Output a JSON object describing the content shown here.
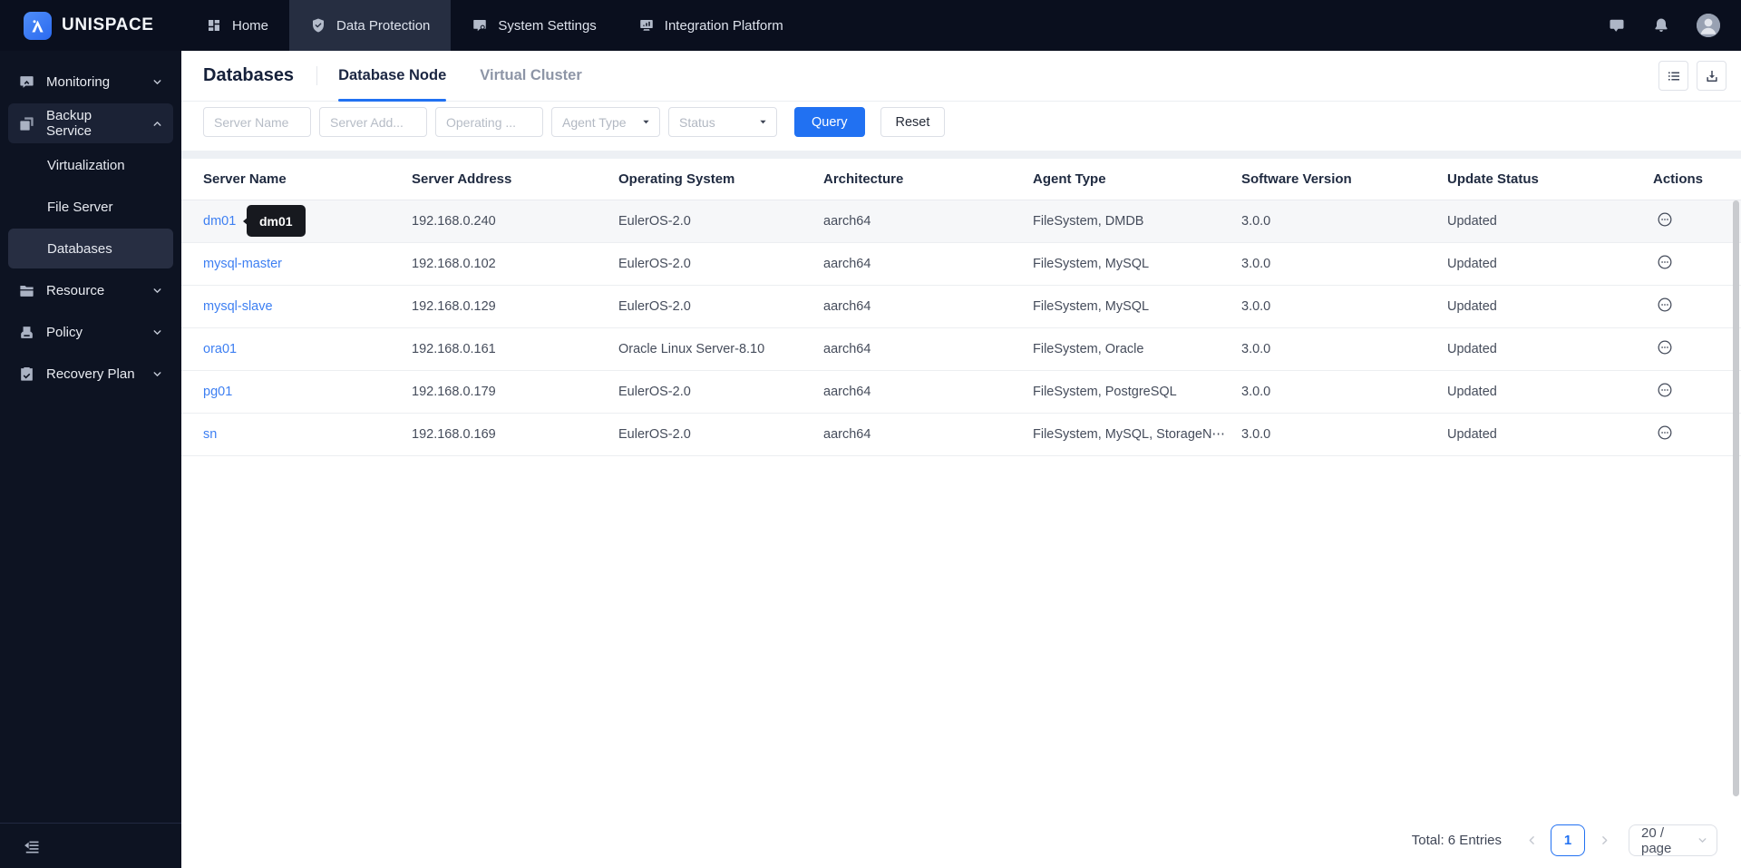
{
  "brand": {
    "name": "UNISPACE"
  },
  "topnav": {
    "items": [
      {
        "label": "Home",
        "icon": "home-grid-icon",
        "active": false
      },
      {
        "label": "Data Protection",
        "icon": "shield-icon",
        "active": true
      },
      {
        "label": "System Settings",
        "icon": "system-settings-icon",
        "active": false
      },
      {
        "label": "Integration Platform",
        "icon": "integration-platform-icon",
        "active": false
      }
    ]
  },
  "sidebar": {
    "items": [
      {
        "label": "Monitoring",
        "icon": "monitoring-icon",
        "type": "parent",
        "chevron": "down",
        "active": false
      },
      {
        "label": "Backup Service",
        "icon": "backup-icon",
        "type": "parent",
        "chevron": "up",
        "active": true
      },
      {
        "label": "Virtualization",
        "type": "child",
        "selected": false
      },
      {
        "label": "File Server",
        "type": "child",
        "selected": false
      },
      {
        "label": "Databases",
        "type": "child",
        "selected": true
      },
      {
        "label": "Resource",
        "icon": "folder-icon",
        "type": "parent",
        "chevron": "down",
        "active": false
      },
      {
        "label": "Policy",
        "icon": "policy-icon",
        "type": "parent",
        "chevron": "down",
        "active": false
      },
      {
        "label": "Recovery Plan",
        "icon": "recovery-plan-icon",
        "type": "parent",
        "chevron": "down",
        "active": false
      }
    ]
  },
  "page": {
    "title": "Databases",
    "tabs": [
      {
        "label": "Database Node",
        "active": true
      },
      {
        "label": "Virtual Cluster",
        "active": false
      }
    ]
  },
  "filters": {
    "inputs": [
      {
        "placeholder": "Server Name"
      },
      {
        "placeholder": "Server Add..."
      },
      {
        "placeholder": "Operating ..."
      }
    ],
    "selects": [
      {
        "placeholder": "Agent Type"
      },
      {
        "placeholder": "Status"
      }
    ],
    "query_label": "Query",
    "reset_label": "Reset"
  },
  "table": {
    "columns": [
      "Server Name",
      "Server Address",
      "Operating System",
      "Architecture",
      "Agent Type",
      "Software Version",
      "Update Status",
      "Actions"
    ],
    "rows": [
      {
        "server_name": "dm01",
        "server_address": "192.168.0.240",
        "operating_system": "EulerOS-2.0",
        "architecture": "aarch64",
        "agent_type": "FileSystem, DMDB",
        "software_version": "3.0.0",
        "update_status": "Updated",
        "hover": true
      },
      {
        "server_name": "mysql-master",
        "server_address": "192.168.0.102",
        "operating_system": "EulerOS-2.0",
        "architecture": "aarch64",
        "agent_type": "FileSystem, MySQL",
        "software_version": "3.0.0",
        "update_status": "Updated",
        "hover": false
      },
      {
        "server_name": "mysql-slave",
        "server_address": "192.168.0.129",
        "operating_system": "EulerOS-2.0",
        "architecture": "aarch64",
        "agent_type": "FileSystem, MySQL",
        "software_version": "3.0.0",
        "update_status": "Updated",
        "hover": false
      },
      {
        "server_name": "ora01",
        "server_address": "192.168.0.161",
        "operating_system": "Oracle Linux Server-8.10",
        "architecture": "aarch64",
        "agent_type": "FileSystem, Oracle",
        "software_version": "3.0.0",
        "update_status": "Updated",
        "hover": false
      },
      {
        "server_name": "pg01",
        "server_address": "192.168.0.179",
        "operating_system": "EulerOS-2.0",
        "architecture": "aarch64",
        "agent_type": "FileSystem, PostgreSQL",
        "software_version": "3.0.0",
        "update_status": "Updated",
        "hover": false
      },
      {
        "server_name": "sn",
        "server_address": "192.168.0.169",
        "operating_system": "EulerOS-2.0",
        "architecture": "aarch64",
        "agent_type": "FileSystem, MySQL, StorageN⋯",
        "software_version": "3.0.0",
        "update_status": "Updated",
        "hover": false
      }
    ]
  },
  "tooltip": {
    "text": "dm01"
  },
  "pagination": {
    "total_text": "Total: 6 Entries",
    "current_page": "1",
    "page_size": "20 / page"
  },
  "colors": {
    "accent": "#2171f2",
    "link": "#3d7ff2",
    "topbar_bg": "#0a0f1e",
    "sidebar_bg": "#0d1322",
    "content_bg": "#edf0f4",
    "tooltip_bg": "#17191f"
  }
}
